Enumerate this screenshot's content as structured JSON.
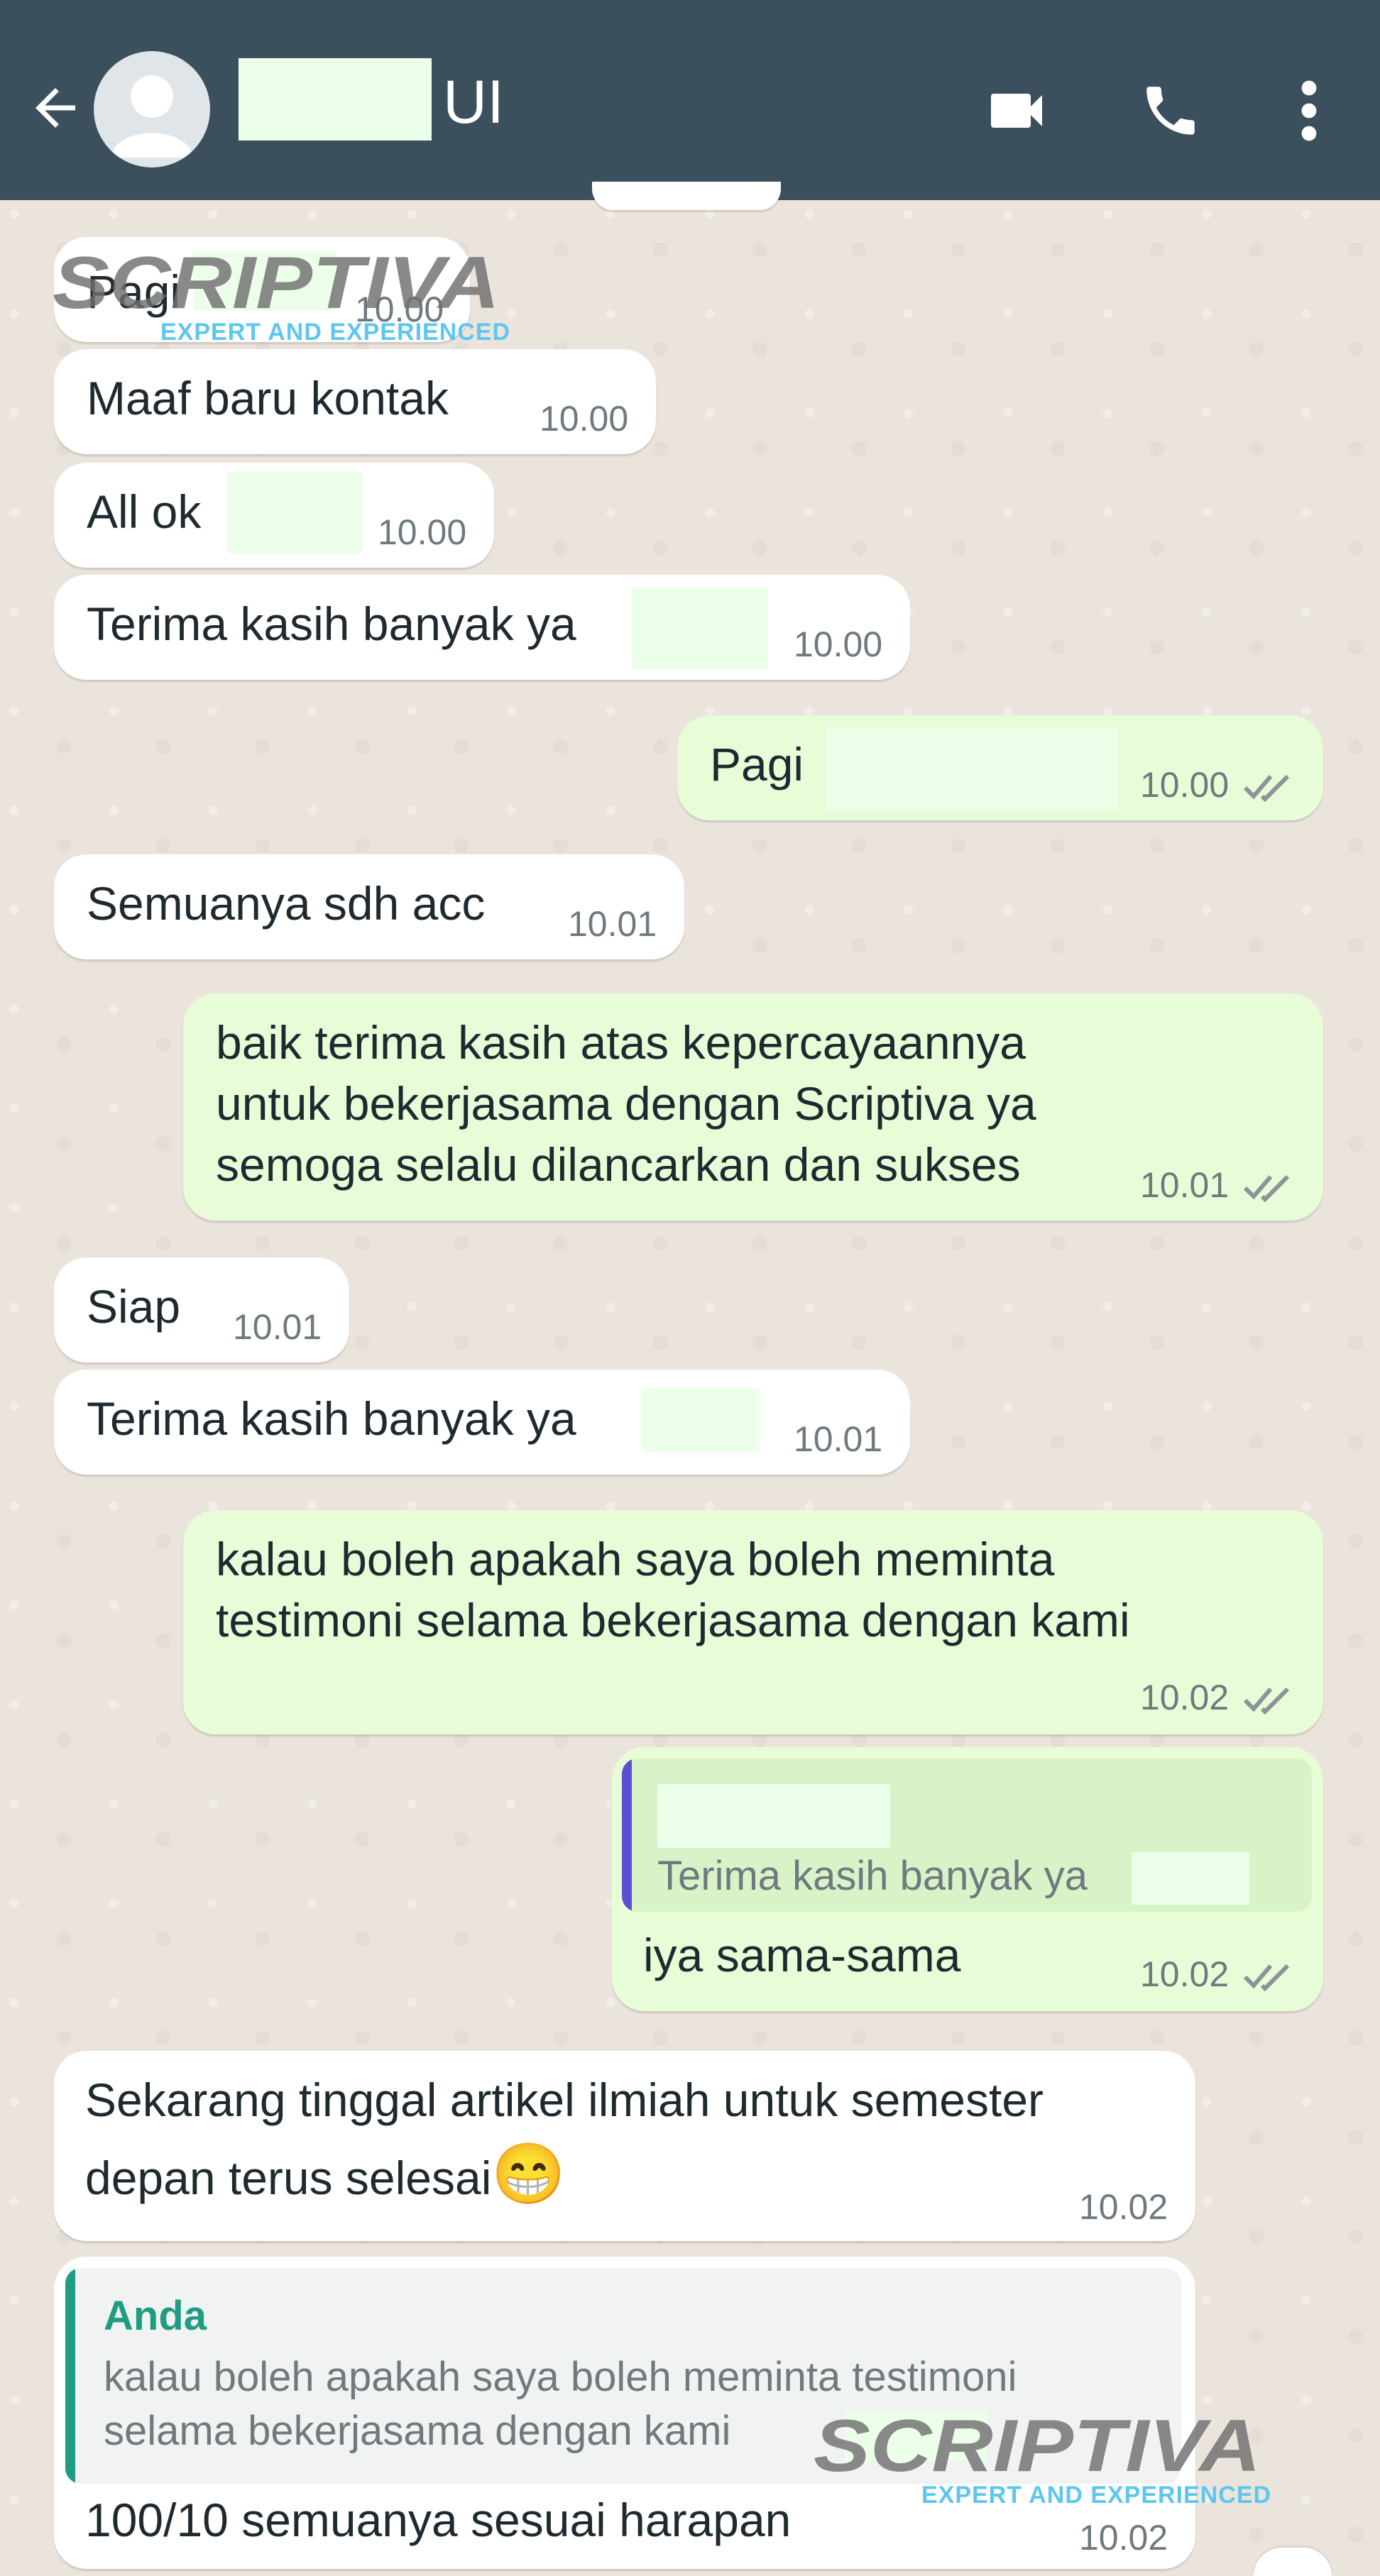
{
  "header": {
    "contact_name_suffix": "UI",
    "back_icon": "arrow-left-icon",
    "video_icon": "video-camera-icon",
    "call_icon": "phone-icon",
    "menu_icon": "more-vertical-icon",
    "bg_color": "#3b4f5c"
  },
  "watermark": {
    "brand": "SCRIPTIVA",
    "tagline": "EXPERT AND EXPERIENCED"
  },
  "messages": [
    {
      "dir": "in",
      "text": "Pagi",
      "time": "10.00"
    },
    {
      "dir": "in",
      "text": "Maaf baru kontak",
      "time": "10.00"
    },
    {
      "dir": "in",
      "text": "All ok",
      "time": "10.00"
    },
    {
      "dir": "in",
      "text": "Terima kasih banyak ya",
      "time": "10.00"
    },
    {
      "dir": "out",
      "text": "Pagi",
      "time": "10.00"
    },
    {
      "dir": "in",
      "text": "Semuanya sdh acc",
      "time": "10.01"
    },
    {
      "dir": "out",
      "lines": [
        "baik          terima kasih atas kepercayaannya",
        "untuk bekerjasama dengan Scriptiva ya",
        "semoga selalu dilancarkan dan sukses"
      ],
      "time": "10.01"
    },
    {
      "dir": "in",
      "text": "Siap",
      "time": "10.01"
    },
    {
      "dir": "in",
      "text": "Terima kasih banyak ya",
      "time": "10.01"
    },
    {
      "dir": "out",
      "lines": [
        "kalau boleh apakah saya boleh meminta",
        "testimoni selama bekerjasama dengan kami"
      ],
      "time": "10.02"
    },
    {
      "dir": "out",
      "quote_text": "Terima kasih banyak ya",
      "text": "iya sama-sama",
      "time": "10.02"
    },
    {
      "dir": "in",
      "lines": [
        "Sekarang tinggal artikel ilmiah untuk semester",
        "depan terus selesai"
      ],
      "emoji": "😁",
      "time": "10.02"
    },
    {
      "dir": "in",
      "quote_author": "Anda",
      "quote_lines": [
        "kalau boleh apakah saya boleh meminta testimoni",
        "selama bekerjasama dengan kami"
      ],
      "text": "100/10 semuanya sesuai harapan",
      "time": "10.02"
    }
  ],
  "colors": {
    "incoming": "#ffffff",
    "outgoing": "#e8fdd7",
    "quote_bar_out": "#5b4fd6",
    "quote_bar_in": "#1f9c82",
    "quote_author": "#1f9c82"
  }
}
